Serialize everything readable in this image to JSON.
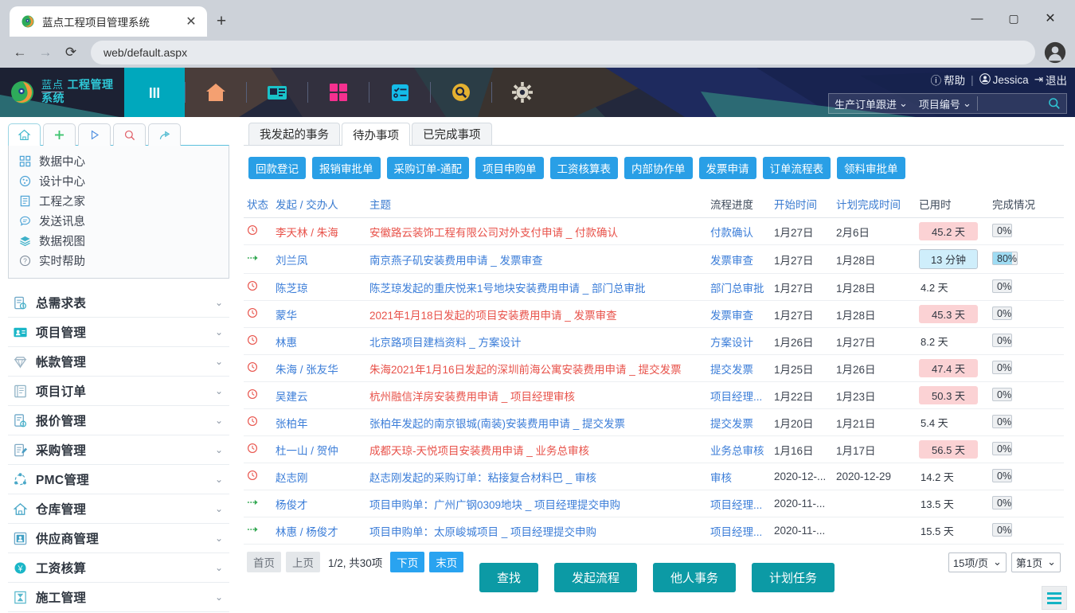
{
  "browser": {
    "tab_title": "蓝点工程项目管理系统",
    "close_label": "✕",
    "newtab_label": "+",
    "back_icon": "back-arrow-icon",
    "forward_icon": "forward-arrow-icon",
    "reload_icon": "reload-icon",
    "url": "web/default.aspx",
    "window_min": "—",
    "window_max": "▢",
    "window_close": "✕"
  },
  "app_header": {
    "brand_line1": "蓝点",
    "brand_line2": "工程管理系统",
    "nav_icons": [
      "menu-bars-icon",
      "home-icon",
      "news-icon",
      "apps-grid-icon",
      "checklist-icon",
      "search-circle-icon",
      "gear-icon"
    ],
    "help_label": "帮助",
    "user_name": "Jessica",
    "logout_label": "退出",
    "search_scope": "生产订单跟进",
    "search_field": "项目编号",
    "search_value": "",
    "search_placeholder": "",
    "accent_color": "#2ec7d6"
  },
  "sidebar": {
    "quick_tabs": [
      {
        "icon": "home-icon",
        "glyph": "⌂",
        "active": true
      },
      {
        "icon": "plus-icon",
        "glyph": "＋",
        "active": false
      },
      {
        "icon": "play-icon",
        "glyph": "▷",
        "active": false
      },
      {
        "icon": "search-icon",
        "glyph": "○",
        "active": false
      },
      {
        "icon": "share-icon",
        "glyph": "↱",
        "active": false
      }
    ],
    "quick_items": [
      {
        "label": "数据中心",
        "icon": "grid-icon"
      },
      {
        "label": "设计中心",
        "icon": "palette-icon"
      },
      {
        "label": "工程之家",
        "icon": "document-icon"
      },
      {
        "label": "发送讯息",
        "icon": "message-icon"
      },
      {
        "label": "数据视图",
        "icon": "layers-icon"
      },
      {
        "label": "实时帮助",
        "icon": "question-icon"
      }
    ],
    "menu_items": [
      {
        "label": "总需求表",
        "icon": "clipboard-clock-icon"
      },
      {
        "label": "项目管理",
        "icon": "id-card-icon"
      },
      {
        "label": "帐款管理",
        "icon": "diamond-icon"
      },
      {
        "label": "项目订单",
        "icon": "book-icon"
      },
      {
        "label": "报价管理",
        "icon": "quote-icon"
      },
      {
        "label": "采购管理",
        "icon": "edit-doc-icon"
      },
      {
        "label": "PMC管理",
        "icon": "network-icon"
      },
      {
        "label": "仓库管理",
        "icon": "warehouse-icon"
      },
      {
        "label": "供应商管理",
        "icon": "supplier-icon"
      },
      {
        "label": "工资核算",
        "icon": "payroll-icon"
      },
      {
        "label": "施工管理",
        "icon": "hourglass-icon"
      }
    ],
    "chevron": "⌄"
  },
  "content": {
    "tabs": [
      {
        "label": "我发起的事务",
        "active": false
      },
      {
        "label": "待办事项",
        "active": true
      },
      {
        "label": "已完成事项",
        "active": false
      }
    ],
    "chips": [
      "回款登记",
      "报销审批单",
      "采购订单-通配",
      "项目申购单",
      "工资核算表",
      "内部协作单",
      "发票申请",
      "订单流程表",
      "领料审批单"
    ],
    "columns": [
      "状态",
      "发起 / 交办人",
      "主题",
      "流程进度",
      "开始时间",
      "计划完成时间",
      "已用时",
      "完成情况"
    ],
    "rows": [
      {
        "status": "clock",
        "person": "李天林 / 朱海",
        "person_color": "red",
        "subject": "安徽路云装饰工程有限公司对外支付申请 _ 付款确认",
        "subject_color": "red",
        "progress": "付款确认",
        "start": "1月27日",
        "plan": "2月6日",
        "used": "45.2 天",
        "used_style": "red",
        "pct": "0%",
        "pct_value": 0
      },
      {
        "status": "arrow",
        "person": "刘兰凤",
        "person_color": "blue",
        "subject": "南京燕子矶安装费用申请 _ 发票审查",
        "subject_color": "blue",
        "progress": "发票审查",
        "start": "1月27日",
        "plan": "1月28日",
        "used": "13 分钟",
        "used_style": "blue",
        "pct": "80%",
        "pct_value": 80
      },
      {
        "status": "clock",
        "person": "陈芝琼",
        "person_color": "blue",
        "subject": "陈芝琼发起的重庆悦来1号地块安装费用申请 _ 部门总审批",
        "subject_color": "blue",
        "progress": "部门总审批",
        "start": "1月27日",
        "plan": "1月28日",
        "used": "4.2 天",
        "used_style": "none",
        "pct": "0%",
        "pct_value": 0
      },
      {
        "status": "clock",
        "person": "蒙华",
        "person_color": "blue",
        "subject": "2021年1月18日发起的项目安装费用申请 _ 发票审查",
        "subject_color": "red",
        "progress": "发票审查",
        "start": "1月27日",
        "plan": "1月28日",
        "used": "45.3 天",
        "used_style": "red",
        "pct": "0%",
        "pct_value": 0
      },
      {
        "status": "clock",
        "person": "林惠",
        "person_color": "blue",
        "subject": "北京路项目建档资料 _ 方案设计",
        "subject_color": "blue",
        "progress": "方案设计",
        "start": "1月26日",
        "plan": "1月27日",
        "used": "8.2 天",
        "used_style": "none",
        "pct": "0%",
        "pct_value": 0
      },
      {
        "status": "clock",
        "person": "朱海 / 张友华",
        "person_color": "blue",
        "subject": "朱海2021年1月16日发起的深圳前海公寓安装费用申请 _ 提交发票",
        "subject_color": "red",
        "progress": "提交发票",
        "start": "1月25日",
        "plan": "1月26日",
        "used": "47.4 天",
        "used_style": "red",
        "pct": "0%",
        "pct_value": 0
      },
      {
        "status": "clock",
        "person": "吴建云",
        "person_color": "blue",
        "subject": "杭州融信洋房安装费用申请 _ 项目经理审核",
        "subject_color": "red",
        "progress": "项目经理...",
        "start": "1月22日",
        "plan": "1月23日",
        "used": "50.3 天",
        "used_style": "red",
        "pct": "0%",
        "pct_value": 0
      },
      {
        "status": "clock",
        "person": "张柏年",
        "person_color": "blue",
        "subject": "张柏年发起的南京银城(南装)安装费用申请 _ 提交发票",
        "subject_color": "blue",
        "progress": "提交发票",
        "start": "1月20日",
        "plan": "1月21日",
        "used": "5.4 天",
        "used_style": "none",
        "pct": "0%",
        "pct_value": 0
      },
      {
        "status": "clock",
        "person": "杜一山 / 贺仲",
        "person_color": "blue",
        "subject": "成都天琼-天悦项目安装费用申请 _ 业务总审核",
        "subject_color": "red",
        "progress": "业务总审核",
        "start": "1月16日",
        "plan": "1月17日",
        "used": "56.5 天",
        "used_style": "red",
        "pct": "0%",
        "pct_value": 0
      },
      {
        "status": "clock",
        "person": "赵志刚",
        "person_color": "blue",
        "subject": "赵志刚发起的采购订单：粘接复合材料巴 _ 审核",
        "subject_color": "blue",
        "progress": "审核",
        "start": "2020-12-...",
        "plan": "2020-12-29",
        "used": "14.2 天",
        "used_style": "none",
        "pct": "0%",
        "pct_value": 0
      },
      {
        "status": "arrow",
        "person": "杨俊才",
        "person_color": "blue",
        "subject": "项目申购单：广州广钢0309地块 _ 项目经理提交申购",
        "subject_color": "blue",
        "progress": "项目经理...",
        "start": "2020-11-...",
        "plan": "",
        "used": "13.5 天",
        "used_style": "none",
        "pct": "0%",
        "pct_value": 0
      },
      {
        "status": "arrow",
        "person": "林惠 / 杨俊才",
        "person_color": "blue",
        "subject": "项目申购单：太原峻城项目 _ 项目经理提交申购",
        "subject_color": "blue",
        "progress": "项目经理...",
        "start": "2020-11-...",
        "plan": "",
        "used": "15.5 天",
        "used_style": "none",
        "pct": "0%",
        "pct_value": 0
      }
    ],
    "pager": {
      "first": "首页",
      "prev": "上页",
      "info": "1/2, 共30项",
      "next": "下页",
      "last": "末页",
      "page_size": "15项/页",
      "page_number": "第1页"
    },
    "actions": [
      "查找",
      "发起流程",
      "他人事务",
      "计划任务"
    ],
    "corner_icon": "list-menu-icon"
  }
}
